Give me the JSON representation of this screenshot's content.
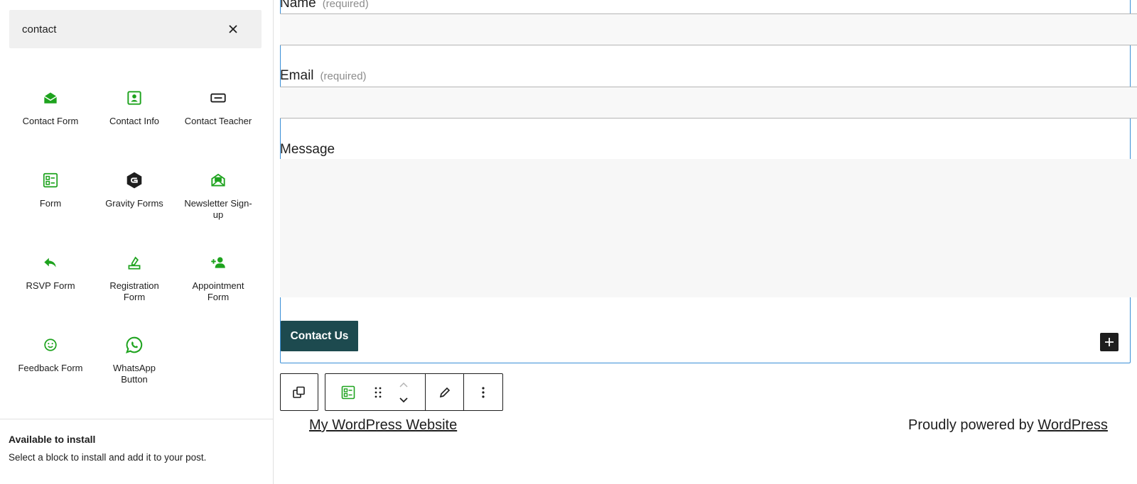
{
  "search": {
    "value": "contact"
  },
  "blocks": [
    {
      "label": "Contact Form",
      "icon": "envelope-open-icon"
    },
    {
      "label": "Contact Info",
      "icon": "contact-card-icon"
    },
    {
      "label": "Contact Teacher",
      "icon": "message-box-icon"
    },
    {
      "label": "Form",
      "icon": "form-icon"
    },
    {
      "label": "Gravity Forms",
      "icon": "gravity-forms-icon"
    },
    {
      "label": "Newsletter Sign-up",
      "icon": "newsletter-icon"
    },
    {
      "label": "RSVP Form",
      "icon": "reply-arrow-icon"
    },
    {
      "label": "Registration Form",
      "icon": "registration-icon"
    },
    {
      "label": "Appointment Form",
      "icon": "person-add-icon"
    },
    {
      "label": "Feedback Form",
      "icon": "smiley-icon"
    },
    {
      "label": "WhatsApp Button",
      "icon": "whatsapp-icon"
    }
  ],
  "install": {
    "title": "Available to install",
    "description": "Select a block to install and add it to your post."
  },
  "form": {
    "name_label": "Name",
    "email_label": "Email",
    "required_text": "(required)",
    "message_label": "Message",
    "submit_label": "Contact Us"
  },
  "footer": {
    "site_title": "My WordPress Website",
    "powered_prefix": "Proudly powered by",
    "powered_link": "WordPress"
  },
  "colors": {
    "icon_green": "#1ea31e",
    "selection_blue": "#3a8fd6",
    "button_bg": "#1d4a4f"
  }
}
